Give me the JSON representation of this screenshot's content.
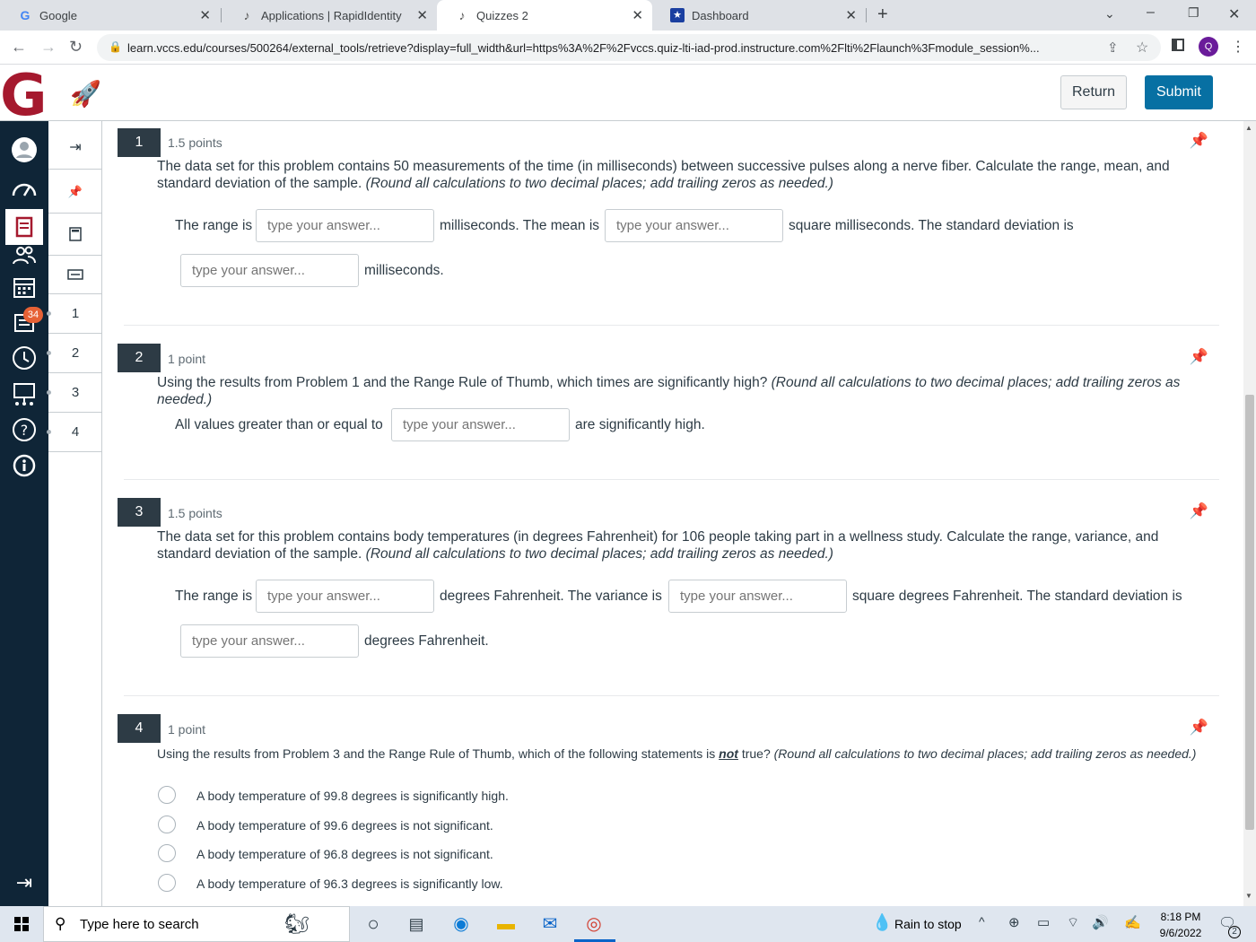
{
  "browser": {
    "tabs": [
      {
        "label": "Google",
        "icon": "google-icon"
      },
      {
        "label": "Applications | RapidIdentity",
        "icon": "rapididentity-icon"
      },
      {
        "label": "Quizzes 2",
        "icon": "quiz-icon",
        "active": true
      },
      {
        "label": "Dashboard",
        "icon": "dashboard-icon"
      }
    ],
    "new_tab": "+",
    "url": "learn.vccs.edu/courses/500264/external_tools/retrieve?display=full_width&url=https%3A%2F%2Fvccs.quiz-lti-iad-prod.instructure.com%2Flti%2Flaunch%3Fmodule_session%...",
    "profile_initial": "Q"
  },
  "header": {
    "logo_letter": "G",
    "return_label": "Return",
    "submit_label": "Submit"
  },
  "global_nav": {
    "inbox_badge": "34"
  },
  "quiz_sidebar": {
    "items": [
      "1",
      "2",
      "3",
      "4"
    ]
  },
  "questions": [
    {
      "number": "1",
      "points": "1.5 points",
      "text": "The data set for this problem contains 50 measurements of the time (in milliseconds) between successive pulses along a nerve fiber. Calculate the range, mean, and standard deviation of the sample. ",
      "note": "(Round all calculations to two decimal places; add trailing zeros as needed.)",
      "label_range": "The range is",
      "label_mid": "milliseconds. The mean is",
      "label_end": "square milliseconds. The standard deviation is",
      "label_unit": "milliseconds.",
      "placeholder": "type your answer..."
    },
    {
      "number": "2",
      "points": "1 point",
      "text": "Using the results from Problem 1 and the Range Rule of Thumb, which times are significantly high? ",
      "note": "(Round all calculations to two decimal places; add trailing zeros as needed.)",
      "label_pre": "All values greater than or equal to",
      "label_post": "are significantly high.",
      "placeholder": "type your answer..."
    },
    {
      "number": "3",
      "points": "1.5 points",
      "text": "The data set for this problem contains body temperatures (in degrees Fahrenheit) for 106 people taking part in a wellness study. Calculate the range, variance, and standard deviation of the sample. ",
      "note": "(Round all calculations to two decimal places; add trailing zeros as needed.)",
      "label_range": "The range is",
      "label_mid": "degrees Fahrenheit. The variance is",
      "label_end": "square degrees Fahrenheit. The standard deviation is",
      "label_unit": "degrees Fahrenheit.",
      "placeholder": "type your answer..."
    },
    {
      "number": "4",
      "points": "1 point",
      "text_pre": "Using the results from Problem 3 and the Range Rule of Thumb, which of the following statements is ",
      "text_emph": "not",
      "text_post": " true? ",
      "note": "(Round all calculations to two decimal places; add trailing zeros as needed.)",
      "options": [
        "A body temperature of 99.8 degrees is significantly high.",
        "A body temperature of 99.6 degrees is not significant.",
        "A body temperature of 96.8 degrees is not significant.",
        "A body temperature of 96.3 degrees is significantly low."
      ]
    }
  ],
  "taskbar": {
    "search_placeholder": "Type here to search",
    "weather": "Rain to stop",
    "time": "8:18 PM",
    "date": "9/6/2022",
    "notif_count": "2"
  }
}
